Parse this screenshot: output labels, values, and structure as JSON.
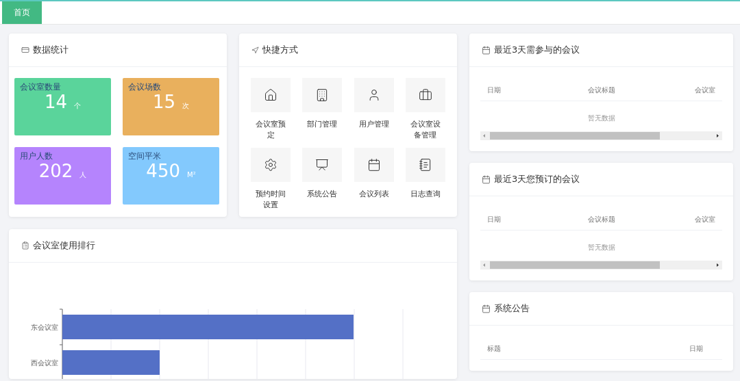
{
  "tab_bar": {
    "tabs": [
      {
        "label": "首页",
        "selected": true
      }
    ]
  },
  "stats_card": {
    "title": "数据统计",
    "tiles": [
      {
        "label": "会议室数量",
        "value": "14",
        "unit": "个",
        "color": "#5ad49b"
      },
      {
        "label": "会议场数",
        "value": "15",
        "unit": "次",
        "color": "#e9b05d"
      },
      {
        "label": "用户人数",
        "value": "202",
        "unit": "人",
        "color": "#b584fd"
      },
      {
        "label": "空间平米",
        "value": "450",
        "unit": "M²",
        "color": "#83c9fd"
      }
    ]
  },
  "shortcuts_card": {
    "title": "快捷方式",
    "items": [
      "会议室预定",
      "部门管理",
      "用户管理",
      "会议室设备管理",
      "预约时间设置",
      "系统公告",
      "会议列表",
      "日志查询"
    ]
  },
  "usage_chart_card": {
    "title": "会议室使用排行",
    "bar_labels": [
      "东会议室",
      "西会议室"
    ]
  },
  "meetings_to_attend": {
    "title": "最近3天需参与的会议",
    "columns": [
      "日期",
      "会议标题",
      "会议室"
    ],
    "empty_text": "暂无数据"
  },
  "my_bookings": {
    "title": "最近3天您预订的会议",
    "columns": [
      "日期",
      "会议标题",
      "会议室"
    ],
    "empty_text": "暂无数据"
  },
  "announcements": {
    "title": "系统公告",
    "columns": [
      "标题",
      "日期"
    ]
  }
}
